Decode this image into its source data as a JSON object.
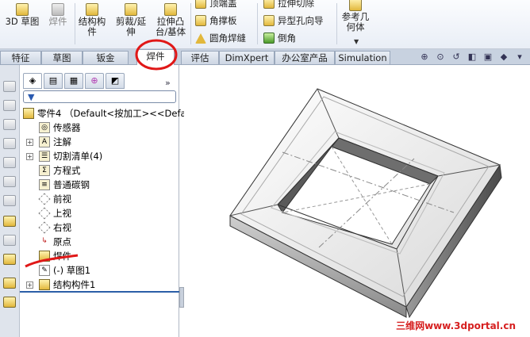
{
  "ribbon": {
    "sketch3d": "3D 草图",
    "weldments_disabled": "焊件",
    "structural_member": "结构构件",
    "trim_extend": "剪裁/延伸",
    "extruded_boss": "拉伸凸台/基体",
    "end_cap": "顶端盖",
    "gusset": "角撑板",
    "fillet_bead": "圆角焊缝",
    "extruded_cut": "拉伸切除",
    "hole_wizard": "异型孔向导",
    "chamfer": "倒角",
    "ref_geometry": "参考几何体"
  },
  "tabs": [
    "特征",
    "草图",
    "钣金",
    "焊件",
    "评估",
    "DimXpert",
    "办公室产品",
    "Simulation"
  ],
  "active_tab": "焊件",
  "tree": {
    "root": "零件4 （Default<按加工><<Defa",
    "items": [
      {
        "label": "传感器",
        "icon": "sensor-icon"
      },
      {
        "label": "注解",
        "icon": "annotation-icon",
        "expandable": true
      },
      {
        "label": "切割清单(4)",
        "icon": "cut-list-icon",
        "expandable": true
      },
      {
        "label": "方程式",
        "icon": "equations-icon"
      },
      {
        "label": "普通碳钢",
        "icon": "material-icon"
      },
      {
        "label": "前视",
        "icon": "plane-icon"
      },
      {
        "label": "上视",
        "icon": "plane-icon"
      },
      {
        "label": "右视",
        "icon": "plane-icon"
      },
      {
        "label": "原点",
        "icon": "origin-icon"
      },
      {
        "label": "焊件",
        "icon": "weldment-icon"
      },
      {
        "label": "(-) 草图1",
        "icon": "sketch-icon"
      },
      {
        "label": "结构构件1",
        "icon": "structural-member-icon",
        "expandable": true
      }
    ]
  },
  "watermark": "三维网www.3dportal.cn",
  "colors": {
    "accent": "#2b5ea7",
    "annotation": "#e01818",
    "watermark": "#d62020"
  }
}
